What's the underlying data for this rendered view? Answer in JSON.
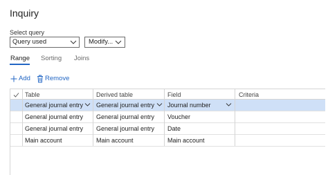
{
  "page": {
    "title": "Inquiry"
  },
  "query": {
    "select_label": "Select query",
    "selected": "Query used",
    "modify_label": "Modify..."
  },
  "tabs": [
    {
      "label": "Range",
      "active": true
    },
    {
      "label": "Sorting",
      "active": false
    },
    {
      "label": "Joins",
      "active": false
    }
  ],
  "toolbar": {
    "add_label": "Add",
    "add_icon": "plus-icon",
    "remove_label": "Remove",
    "remove_icon": "trash-icon"
  },
  "grid": {
    "columns": [
      "Table",
      "Derived table",
      "Field",
      "Criteria"
    ],
    "rows": [
      {
        "table": "General journal entry",
        "derived_table": "General journal entry",
        "field": "Journal number",
        "criteria": "",
        "selected": true
      },
      {
        "table": "General journal entry",
        "derived_table": "General journal entry",
        "field": "Voucher",
        "criteria": "",
        "selected": false
      },
      {
        "table": "General journal entry",
        "derived_table": "General journal entry",
        "field": "Date",
        "criteria": "",
        "selected": false
      },
      {
        "table": "Main account",
        "derived_table": "Main account",
        "field": "Main account",
        "criteria": "",
        "selected": false
      }
    ]
  },
  "colors": {
    "accent": "#2266c4",
    "selected_row": "#cfe0f7",
    "border": "#d4d4d4"
  }
}
